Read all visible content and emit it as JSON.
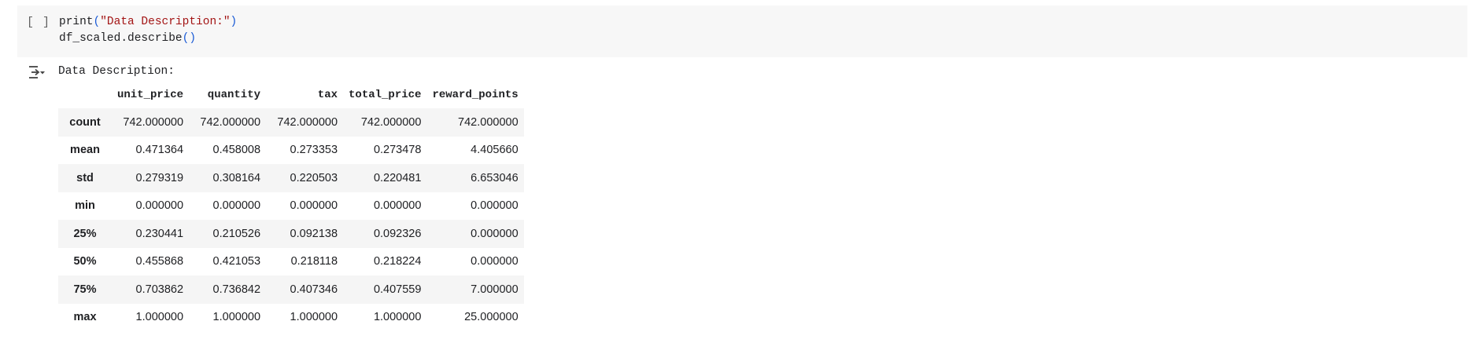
{
  "cell": {
    "exec_count": "[ ]",
    "code_line1": {
      "fn": "print",
      "open": "(",
      "str": "\"Data Description:\"",
      "close": ")"
    },
    "code_line2": {
      "text": "df_scaled.describe",
      "parens": "()"
    }
  },
  "output": {
    "icon": "output-toggle-icon",
    "text": "Data Description:",
    "table": {
      "columns": [
        "unit_price",
        "quantity",
        "tax",
        "total_price",
        "reward_points"
      ],
      "rows": [
        {
          "label": "count",
          "values": [
            "742.000000",
            "742.000000",
            "742.000000",
            "742.000000",
            "742.000000"
          ]
        },
        {
          "label": "mean",
          "values": [
            "0.471364",
            "0.458008",
            "0.273353",
            "0.273478",
            "4.405660"
          ]
        },
        {
          "label": "std",
          "values": [
            "0.279319",
            "0.308164",
            "0.220503",
            "0.220481",
            "6.653046"
          ]
        },
        {
          "label": "min",
          "values": [
            "0.000000",
            "0.000000",
            "0.000000",
            "0.000000",
            "0.000000"
          ]
        },
        {
          "label": "25%",
          "values": [
            "0.230441",
            "0.210526",
            "0.092138",
            "0.092326",
            "0.000000"
          ]
        },
        {
          "label": "50%",
          "values": [
            "0.455868",
            "0.421053",
            "0.218118",
            "0.218224",
            "0.000000"
          ]
        },
        {
          "label": "75%",
          "values": [
            "0.703862",
            "0.736842",
            "0.407346",
            "0.407559",
            "7.000000"
          ]
        },
        {
          "label": "max",
          "values": [
            "1.000000",
            "1.000000",
            "1.000000",
            "1.000000",
            "25.000000"
          ]
        }
      ]
    }
  },
  "colors": {
    "cell_bg": "#f7f7f7",
    "string": "#a31515",
    "paren": "#1a5bd6",
    "alt_row": "#f5f5f5"
  }
}
